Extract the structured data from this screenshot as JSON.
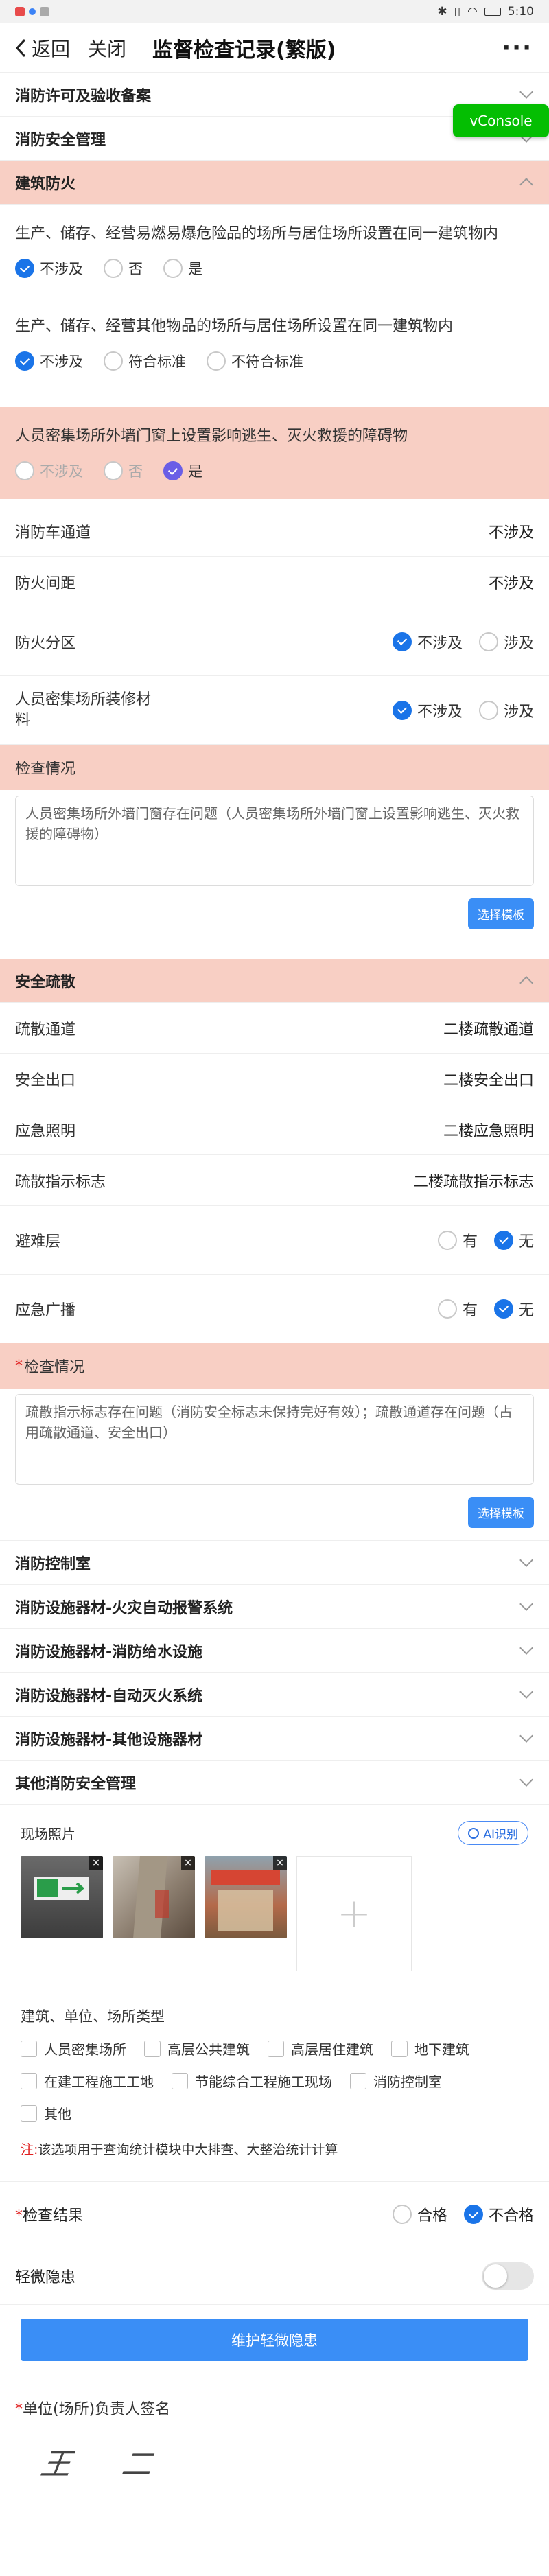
{
  "statusbar": {
    "time": "5:10"
  },
  "nav": {
    "back": "返回",
    "close": "关闭",
    "title": "监督检查记录(繁版)",
    "more": "···"
  },
  "vconsole": "vConsole",
  "sections": {
    "license": "消防许可及验收备案",
    "safety_mgmt": "消防安全管理",
    "building": "建筑防火",
    "evac": "安全疏散",
    "control_room": "消防控制室",
    "alarm": "消防设施器材-火灾自动报警系统",
    "water": "消防设施器材-消防给水设施",
    "extinguish": "消防设施器材-自动灭火系统",
    "other_equip": "消防设施器材-其他设施器材",
    "other_mgmt": "其他消防安全管理"
  },
  "building": {
    "q1": {
      "text": "生产、储存、经营易燃易爆危险品的场所与居住场所设置在同一建筑物内",
      "options": [
        "不涉及",
        "否",
        "是"
      ]
    },
    "q2": {
      "text": "生产、储存、经营其他物品的场所与居住场所设置在同一建筑物内",
      "options": [
        "不涉及",
        "符合标准",
        "不符合标准"
      ]
    },
    "q3": {
      "text": "人员密集场所外墙门窗上设置影响逃生、灭火救援的障碍物",
      "options": [
        "不涉及",
        "否",
        "是"
      ]
    },
    "rows": [
      {
        "label": "消防车通道",
        "value": "不涉及"
      },
      {
        "label": "防火间距",
        "value": "不涉及"
      }
    ],
    "fire_zone": {
      "label": "防火分区",
      "options": [
        "不涉及",
        "涉及"
      ]
    },
    "decoration": {
      "label": "人员密集场所装修材料",
      "options": [
        "不涉及",
        "涉及"
      ]
    },
    "check_label": "检查情况",
    "check_text": "人员密集场所外墙门窗存在问题（人员密集场所外墙门窗上设置影响逃生、灭火救援的障碍物）",
    "tpl_btn": "选择模板"
  },
  "evac": {
    "rows": [
      {
        "label": "疏散通道",
        "value": "二楼疏散通道"
      },
      {
        "label": "安全出口",
        "value": "二楼安全出口"
      },
      {
        "label": "应急照明",
        "value": "二楼应急照明"
      },
      {
        "label": "疏散指示标志",
        "value": "二楼疏散指示标志"
      }
    ],
    "refuge": {
      "label": "避难层",
      "options": [
        "有",
        "无"
      ]
    },
    "broadcast": {
      "label": "应急广播",
      "options": [
        "有",
        "无"
      ]
    },
    "check_label": "检查情况",
    "check_text": "疏散指示标志存在问题（消防安全标志未保持完好有效）；疏散通道存在问题（占用疏散通道、安全出口）",
    "tpl_btn": "选择模板"
  },
  "photos": {
    "label": "现场照片",
    "ai": "AI识别",
    "close": "×",
    "add": "+"
  },
  "types": {
    "label": "建筑、单位、场所类型",
    "items": [
      "人员密集场所",
      "高层公共建筑",
      "高层居住建筑",
      "地下建筑",
      "在建工程施工工地",
      "节能综合工程施工现场",
      "消防控制室",
      "其他"
    ],
    "note_prefix": "注:",
    "note": "该选项用于查询统计模块中大排查、大整治统计计算"
  },
  "result": {
    "label": "检查结果",
    "options": [
      "合格",
      "不合格"
    ]
  },
  "minor": {
    "label": "轻微隐患",
    "btn": "维护轻微隐患"
  },
  "signature": {
    "label": "单位(场所)负责人签名",
    "name": "王 二"
  }
}
